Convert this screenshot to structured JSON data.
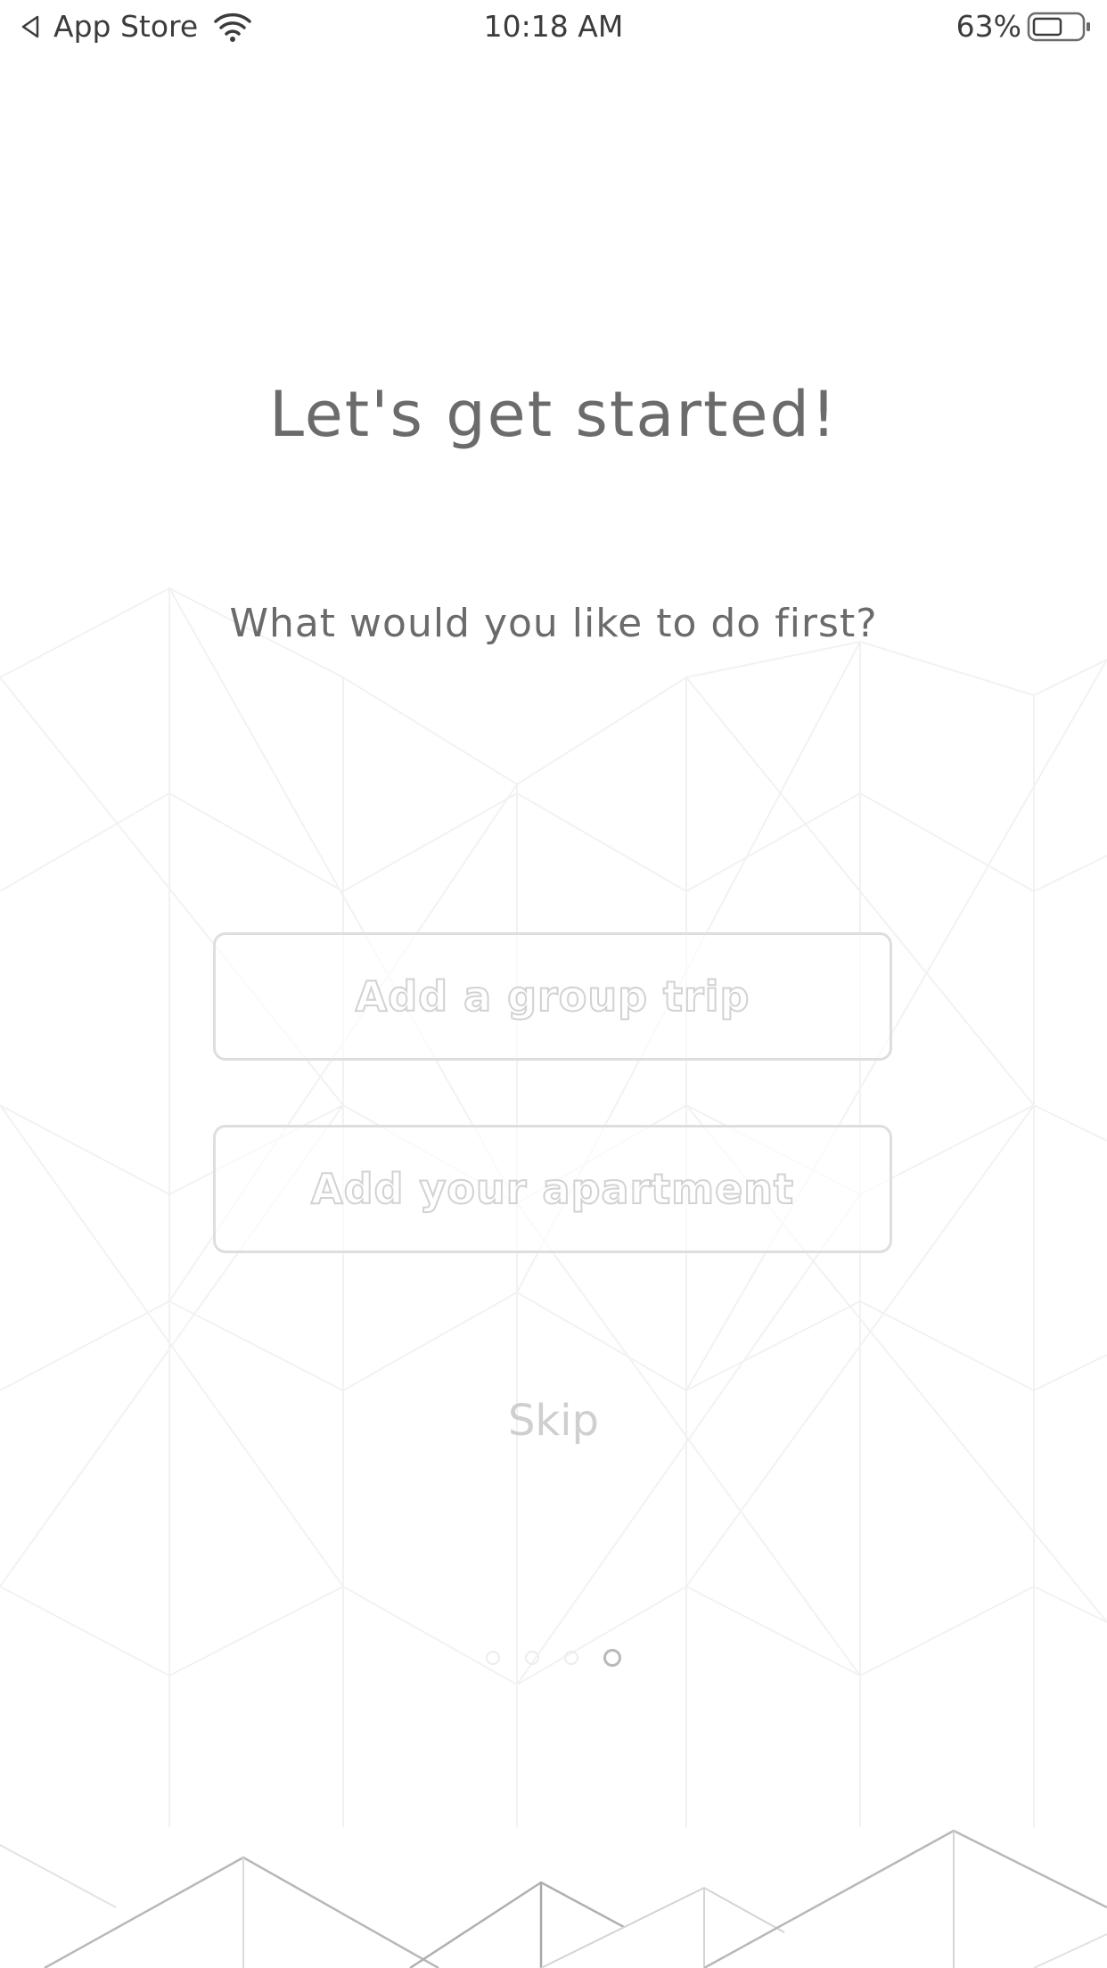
{
  "status_bar": {
    "back_app": "App Store",
    "time": "10:18 AM",
    "battery": "63%"
  },
  "main": {
    "title": "Let's get started!",
    "subtitle": "What would you like to do first?",
    "options": [
      {
        "label": "Add a group trip"
      },
      {
        "label": "Add your apartment"
      }
    ],
    "skip_label": "Skip"
  },
  "pager": {
    "page_count": 4,
    "active_index": 3
  },
  "colors": {
    "text_primary": "#6b6b6b",
    "button_border": "#dedede",
    "skip_text": "#cfcfcf",
    "background": "#ffffff"
  },
  "icons": [
    "back-arrow-icon",
    "wifi-icon",
    "battery-icon"
  ]
}
